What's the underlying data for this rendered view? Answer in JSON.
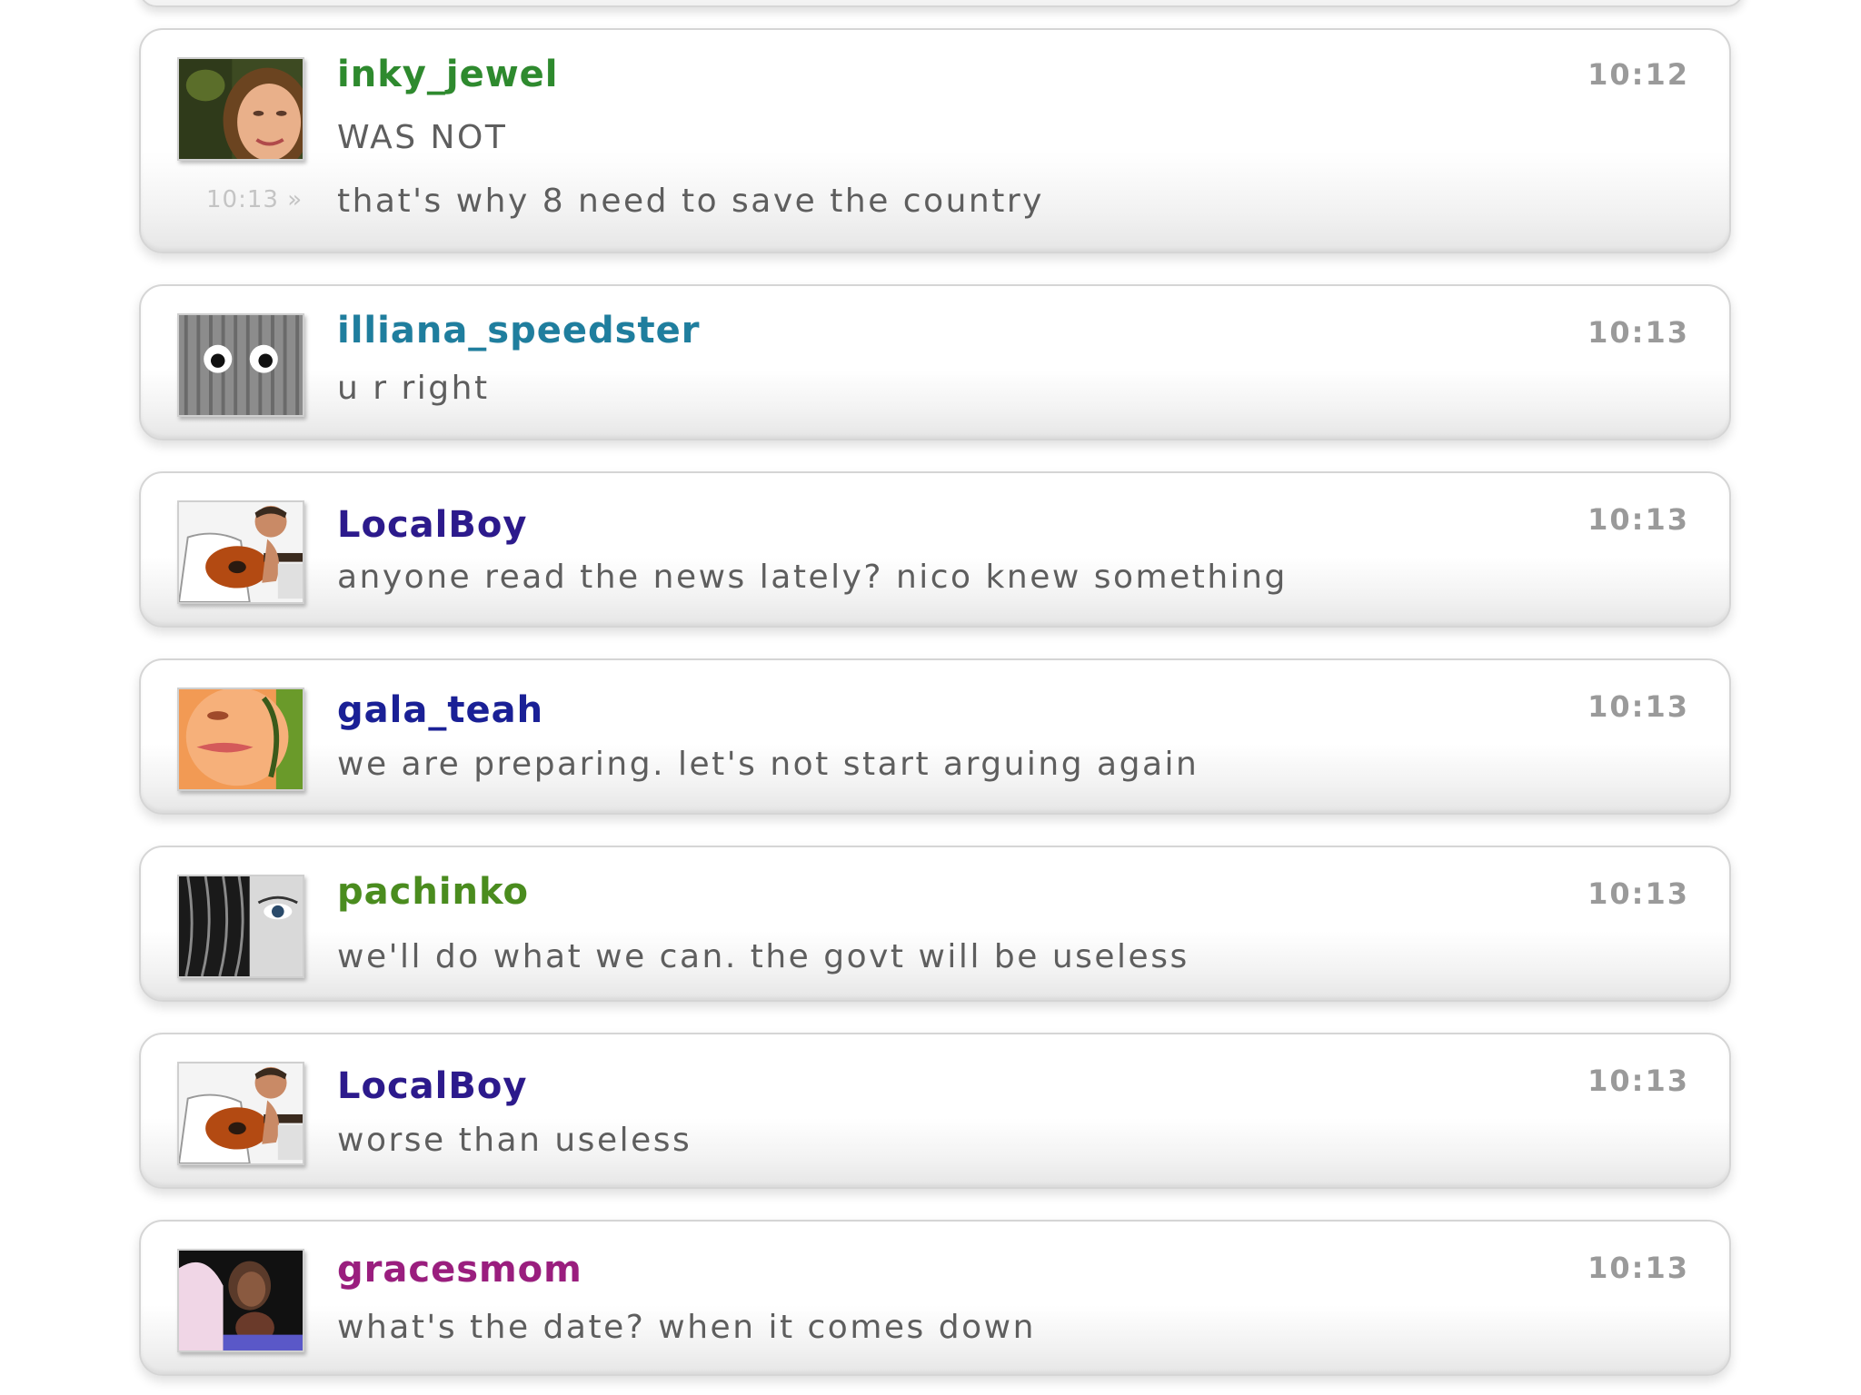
{
  "messages": [
    {
      "username": "inky_jewel",
      "user_color": "#2e8a2e",
      "time": "10:12",
      "text": "WAS NOT",
      "followup": {
        "time": "10:13 »",
        "text": "that's why 8 need to save the country"
      },
      "avatar": "avatar-woman-photo"
    },
    {
      "username": "illiana_speedster",
      "user_color": "#1f7e9e",
      "time": "10:13",
      "text": "u r right",
      "avatar": "avatar-googly-eyes"
    },
    {
      "username": "LocalBoy",
      "user_color": "#2c1a8c",
      "time": "10:13",
      "text": "anyone read the news lately? nico knew something",
      "avatar": "avatar-guitar-player"
    },
    {
      "username": "gala_teah",
      "user_color": "#1a2096",
      "time": "10:13",
      "text": "we are preparing. let's not start arguing again",
      "avatar": "avatar-painted-face"
    },
    {
      "username": "pachinko",
      "user_color": "#4a8c1e",
      "time": "10:13",
      "text": "we'll do what we can. the govt will be useless",
      "avatar": "avatar-hair-eye"
    },
    {
      "username": "LocalBoy",
      "user_color": "#2c1a8c",
      "time": "10:13",
      "text": "worse than useless",
      "avatar": "avatar-guitar-player"
    },
    {
      "username": "gracesmom",
      "user_color": "#9a1e7e",
      "time": "10:13",
      "text": "what's the date? when it comes down",
      "avatar": "avatar-mother-child"
    }
  ]
}
